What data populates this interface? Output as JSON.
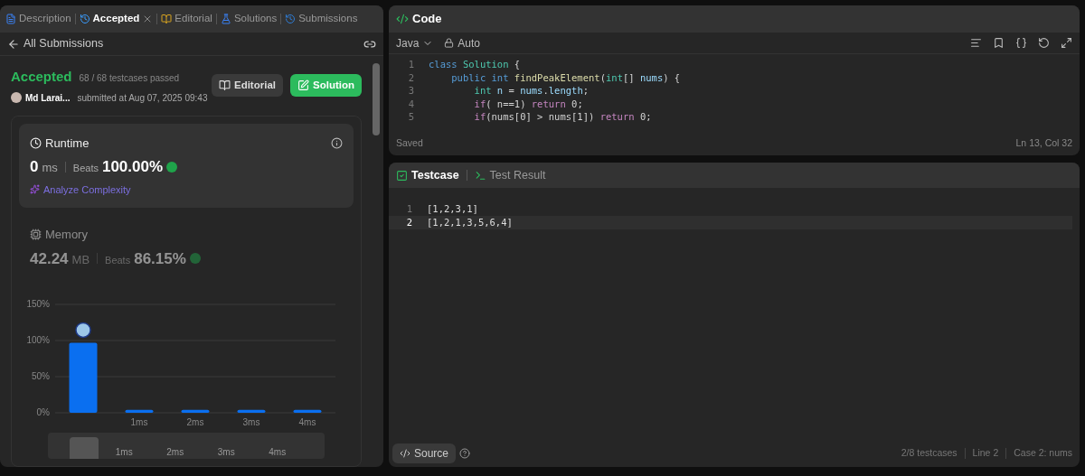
{
  "left_tabs": [
    {
      "label": "Description",
      "selected": false,
      "closable": false
    },
    {
      "label": "Accepted",
      "selected": true,
      "closable": true
    },
    {
      "label": "Editorial",
      "selected": false,
      "closable": false
    },
    {
      "label": "Solutions",
      "selected": false,
      "closable": false
    },
    {
      "label": "Submissions",
      "selected": false,
      "closable": false
    }
  ],
  "back_link": "All Submissions",
  "result": {
    "status": "Accepted",
    "testcases": "68 / 68 testcases passed",
    "user": "Md Larai...",
    "submitted": "submitted at Aug 07, 2025 09:43"
  },
  "buttons": [
    {
      "label": "Editorial",
      "kind": "secondary"
    },
    {
      "label": "Solution",
      "kind": "primary"
    }
  ],
  "runtime": {
    "title": "Runtime",
    "value": "0",
    "unit": "ms",
    "beats_label": "Beats",
    "beats": "100.00%",
    "analyze": "Analyze Complexity",
    "selected": true
  },
  "memory": {
    "title": "Memory",
    "value": "42.24",
    "unit": "MB",
    "beats_label": "Beats",
    "beats": "86.15%",
    "selected": false
  },
  "chart_data": {
    "type": "bar",
    "categories": [
      null,
      "1ms",
      "2ms",
      "3ms",
      "4ms"
    ],
    "values": [
      97,
      4,
      4,
      4,
      4
    ],
    "ylim": [
      0,
      150
    ],
    "yticks": [
      {
        "value": 0,
        "label": "0%"
      },
      {
        "value": 50,
        "label": "50%"
      },
      {
        "value": 100,
        "label": "100%"
      },
      {
        "value": 150,
        "label": "150%"
      }
    ]
  },
  "overview_labels": [
    "1ms",
    "2ms",
    "3ms",
    "4ms"
  ],
  "code_panel": {
    "title": "Code",
    "language": "Java",
    "mode": "Auto",
    "status": "Saved",
    "cursor": "Ln 13, Col 32"
  },
  "code_lines": [
    {
      "number": "1",
      "tokens": [
        {
          "kind": "kw",
          "text": "class "
        },
        {
          "kind": "type",
          "text": "Solution"
        },
        {
          "kind": "plain",
          "text": " {"
        }
      ]
    },
    {
      "number": "2",
      "tokens": [
        {
          "kind": "kw",
          "text": "    public int "
        },
        {
          "kind": "fn",
          "text": "findPeakElement"
        },
        {
          "kind": "plain",
          "text": "("
        },
        {
          "kind": "type",
          "text": "int"
        },
        {
          "kind": "plain",
          "text": "[] "
        },
        {
          "kind": "var",
          "text": "nums"
        },
        {
          "kind": "plain",
          "text": ") {"
        }
      ]
    },
    {
      "number": "3",
      "tokens": [
        {
          "kind": "type",
          "text": "        int "
        },
        {
          "kind": "var",
          "text": "n"
        },
        {
          "kind": "plain",
          "text": " = "
        },
        {
          "kind": "var",
          "text": "nums"
        },
        {
          "kind": "plain",
          "text": "."
        },
        {
          "kind": "var",
          "text": "length"
        },
        {
          "kind": "plain",
          "text": ";"
        }
      ]
    },
    {
      "number": "4",
      "tokens": [
        {
          "kind": "ctrl",
          "text": "        if"
        },
        {
          "kind": "plain",
          "text": "( n==1) "
        },
        {
          "kind": "ctrl",
          "text": "return"
        },
        {
          "kind": "plain",
          "text": " 0;"
        }
      ]
    },
    {
      "number": "5",
      "tokens": [
        {
          "kind": "ctrl",
          "text": "        if"
        },
        {
          "kind": "plain",
          "text": "(nums[0] > nums[1]) "
        },
        {
          "kind": "ctrl",
          "text": "return"
        },
        {
          "kind": "plain",
          "text": " 0;"
        }
      ]
    }
  ],
  "bottom_tabs": [
    {
      "label": "Testcase",
      "selected": true
    },
    {
      "label": "Test Result",
      "selected": false
    }
  ],
  "testcase_lines": [
    {
      "number": "1",
      "text": "[1,2,3,1]",
      "selected": false
    },
    {
      "number": "2",
      "text": "[1,2,1,3,5,6,4]",
      "selected": true
    }
  ],
  "source_button": "Source",
  "status": [
    "2/8 testcases",
    "Line 2",
    "Case 2: nums"
  ]
}
